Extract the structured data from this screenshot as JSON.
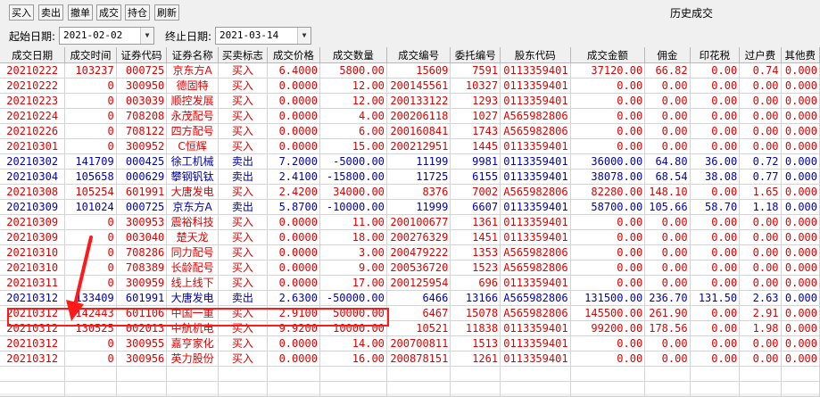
{
  "toolbar": {
    "buttons": [
      "买入",
      "卖出",
      "撤单",
      "成交",
      "持仓",
      "刷新"
    ],
    "title": "历史成交"
  },
  "date_filter": {
    "start_label": "起始日期:",
    "start_value": "2021-02-02",
    "end_label": "终止日期:",
    "end_value": "2021-03-14"
  },
  "table": {
    "columns": [
      "成交日期",
      "成交时间",
      "证券代码",
      "证券名称",
      "买卖标志",
      "成交价格",
      "成交数量",
      "成交编号",
      "委托编号",
      "股东代码",
      "成交金额",
      "佣金",
      "印花税",
      "过户费",
      "其他费"
    ],
    "rows": [
      {
        "side": "buy",
        "cells": [
          "20210222",
          "103237",
          "000725",
          "京东方A",
          "买入",
          "6.4000",
          "5800.00",
          "15609",
          "7591",
          "0113359401",
          "37120.00",
          "66.82",
          "0.00",
          "0.74",
          "0.000"
        ]
      },
      {
        "side": "buy",
        "cells": [
          "20210222",
          "0",
          "300950",
          "德固特",
          "买入",
          "0.0000",
          "12.00",
          "200145561",
          "10327",
          "0113359401",
          "0.00",
          "0.00",
          "0.00",
          "0.00",
          "0.000"
        ]
      },
      {
        "side": "buy",
        "cells": [
          "20210223",
          "0",
          "003039",
          "顺控发展",
          "买入",
          "0.0000",
          "12.00",
          "200133122",
          "1293",
          "0113359401",
          "0.00",
          "0.00",
          "0.00",
          "0.00",
          "0.000"
        ]
      },
      {
        "side": "buy",
        "cells": [
          "20210224",
          "0",
          "708208",
          "永茂配号",
          "买入",
          "0.0000",
          "4.00",
          "200206118",
          "1027",
          "A565982806",
          "0.00",
          "0.00",
          "0.00",
          "0.00",
          "0.000"
        ]
      },
      {
        "side": "buy",
        "cells": [
          "20210226",
          "0",
          "708122",
          "四方配号",
          "买入",
          "0.0000",
          "6.00",
          "200160841",
          "1743",
          "A565982806",
          "0.00",
          "0.00",
          "0.00",
          "0.00",
          "0.000"
        ]
      },
      {
        "side": "buy",
        "cells": [
          "20210301",
          "0",
          "300952",
          "C恒辉",
          "买入",
          "0.0000",
          "15.00",
          "200212951",
          "1445",
          "0113359401",
          "0.00",
          "0.00",
          "0.00",
          "0.00",
          "0.000"
        ]
      },
      {
        "side": "sell",
        "cells": [
          "20210302",
          "141709",
          "000425",
          "徐工机械",
          "卖出",
          "7.2000",
          "-5000.00",
          "11199",
          "9981",
          "0113359401",
          "36000.00",
          "64.80",
          "36.00",
          "0.72",
          "0.000"
        ]
      },
      {
        "side": "sell",
        "cells": [
          "20210304",
          "105658",
          "000629",
          "攀钢钒钛",
          "卖出",
          "2.4100",
          "-15800.00",
          "11725",
          "6155",
          "0113359401",
          "38078.00",
          "68.54",
          "38.08",
          "0.77",
          "0.000"
        ]
      },
      {
        "side": "buy",
        "cells": [
          "20210308",
          "105254",
          "601991",
          "大唐发电",
          "买入",
          "2.4200",
          "34000.00",
          "8376",
          "7002",
          "A565982806",
          "82280.00",
          "148.10",
          "0.00",
          "1.65",
          "0.000"
        ]
      },
      {
        "side": "sell",
        "cells": [
          "20210309",
          "101024",
          "000725",
          "京东方A",
          "卖出",
          "5.8700",
          "-10000.00",
          "11999",
          "6607",
          "0113359401",
          "58700.00",
          "105.66",
          "58.70",
          "1.18",
          "0.000"
        ]
      },
      {
        "side": "buy",
        "cells": [
          "20210309",
          "0",
          "300953",
          "震裕科技",
          "买入",
          "0.0000",
          "11.00",
          "200100677",
          "1361",
          "0113359401",
          "0.00",
          "0.00",
          "0.00",
          "0.00",
          "0.000"
        ]
      },
      {
        "side": "buy",
        "cells": [
          "20210309",
          "0",
          "003040",
          "楚天龙",
          "买入",
          "0.0000",
          "18.00",
          "200276329",
          "1451",
          "0113359401",
          "0.00",
          "0.00",
          "0.00",
          "0.00",
          "0.000"
        ]
      },
      {
        "side": "buy",
        "cells": [
          "20210310",
          "0",
          "708286",
          "同力配号",
          "买入",
          "0.0000",
          "3.00",
          "200479222",
          "1353",
          "A565982806",
          "0.00",
          "0.00",
          "0.00",
          "0.00",
          "0.000"
        ]
      },
      {
        "side": "buy",
        "cells": [
          "20210310",
          "0",
          "708389",
          "长龄配号",
          "买入",
          "0.0000",
          "9.00",
          "200536720",
          "1523",
          "A565982806",
          "0.00",
          "0.00",
          "0.00",
          "0.00",
          "0.000"
        ]
      },
      {
        "side": "buy",
        "cells": [
          "20210311",
          "0",
          "300959",
          "线上线下",
          "买入",
          "0.0000",
          "17.00",
          "200125954",
          "696",
          "0113359401",
          "0.00",
          "0.00",
          "0.00",
          "0.00",
          "0.000"
        ]
      },
      {
        "side": "sell",
        "cells": [
          "20210312",
          "133409",
          "601991",
          "大唐发电",
          "卖出",
          "2.6300",
          "-50000.00",
          "6466",
          "13166",
          "A565982806",
          "131500.00",
          "236.70",
          "131.50",
          "2.63",
          "0.000"
        ]
      },
      {
        "side": "buy",
        "cells": [
          "20210312",
          "142443",
          "601106",
          "中国一重",
          "买入",
          "2.9100",
          "50000.00",
          "6467",
          "15078",
          "A565982806",
          "145500.00",
          "261.90",
          "0.00",
          "2.91",
          "0.000"
        ]
      },
      {
        "side": "buy",
        "cells": [
          "20210312",
          "130525",
          "002013",
          "中航机电",
          "买入",
          "9.9200",
          "10000.00",
          "10521",
          "11838",
          "0113359401",
          "99200.00",
          "178.56",
          "0.00",
          "1.98",
          "0.000"
        ]
      },
      {
        "side": "buy",
        "cells": [
          "20210312",
          "0",
          "300955",
          "嘉亨家化",
          "买入",
          "0.0000",
          "14.00",
          "200700811",
          "1513",
          "0113359401",
          "0.00",
          "0.00",
          "0.00",
          "0.00",
          "0.000"
        ]
      },
      {
        "side": "buy",
        "cells": [
          "20210312",
          "0",
          "300956",
          "英力股份",
          "买入",
          "0.0000",
          "16.00",
          "200878151",
          "1261",
          "0113359401",
          "0.00",
          "0.00",
          "0.00",
          "0.00",
          "0.000"
        ]
      }
    ]
  },
  "colors": {
    "buy": "#e00000",
    "sell": "#0000b4",
    "highlight": "#ff1a1a"
  }
}
